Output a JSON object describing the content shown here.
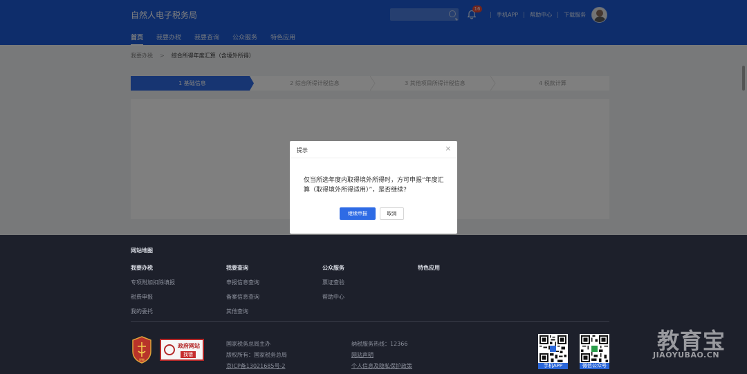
{
  "header": {
    "brand": "自然人电子税务局",
    "notification_count": "16",
    "links": [
      "手机APP",
      "帮助中心",
      "下载服务"
    ],
    "nav": [
      "首页",
      "我要办税",
      "我要查询",
      "公众服务",
      "特色应用"
    ],
    "active_nav": "首页"
  },
  "breadcrumb": {
    "parent": "我要办税",
    "separator": ">",
    "current": "综合所得年度汇算（含境外所得）"
  },
  "steps": [
    {
      "label": "1  基础信息",
      "active": true
    },
    {
      "label": "2  综合所得计税信息",
      "active": false
    },
    {
      "label": "3  其他项目所得计税信息",
      "active": false
    },
    {
      "label": "4  税款计算",
      "active": false
    }
  ],
  "dialog": {
    "title": "提示",
    "close_symbol": "×",
    "message": "仅当所选年度内取得境外所得时，方可申报“年度汇算（取得境外所得适用）”，是否继续?",
    "confirm_label": "继续申报",
    "cancel_label": "取消"
  },
  "footer": {
    "sitemap_title": "网站地图",
    "columns": [
      {
        "title": "我要办税",
        "links": [
          "专项附加扣除填报",
          "税费申报",
          "我的委托"
        ]
      },
      {
        "title": "我要查询",
        "links": [
          "申报信息查询",
          "备案信息查询",
          "其他查询"
        ]
      },
      {
        "title": "公众服务",
        "links": [
          "票证查验",
          "帮助中心"
        ]
      },
      {
        "title": "特色应用",
        "links": []
      }
    ],
    "gov_badge_line1": "政府网站",
    "gov_badge_line2": "找错",
    "emblem_text": "税徽",
    "info_left": [
      "国家税务总局主办",
      "版权所有：国家税务总局",
      "京ICP备13021685号-2"
    ],
    "info_right": [
      "纳税服务热线：12366",
      "网站声明",
      "个人信息及隐私保护政策"
    ],
    "qr_captions": [
      "手机APP",
      "微信公众号"
    ]
  },
  "watermark": {
    "main": "教育宝",
    "sub": "JIAOYUBAO.CN"
  },
  "colors": {
    "brand_blue": "#1d5bd6",
    "accent": "#2e6be5",
    "footer_bg": "#1d202b",
    "badge_red": "#e64a3b"
  }
}
